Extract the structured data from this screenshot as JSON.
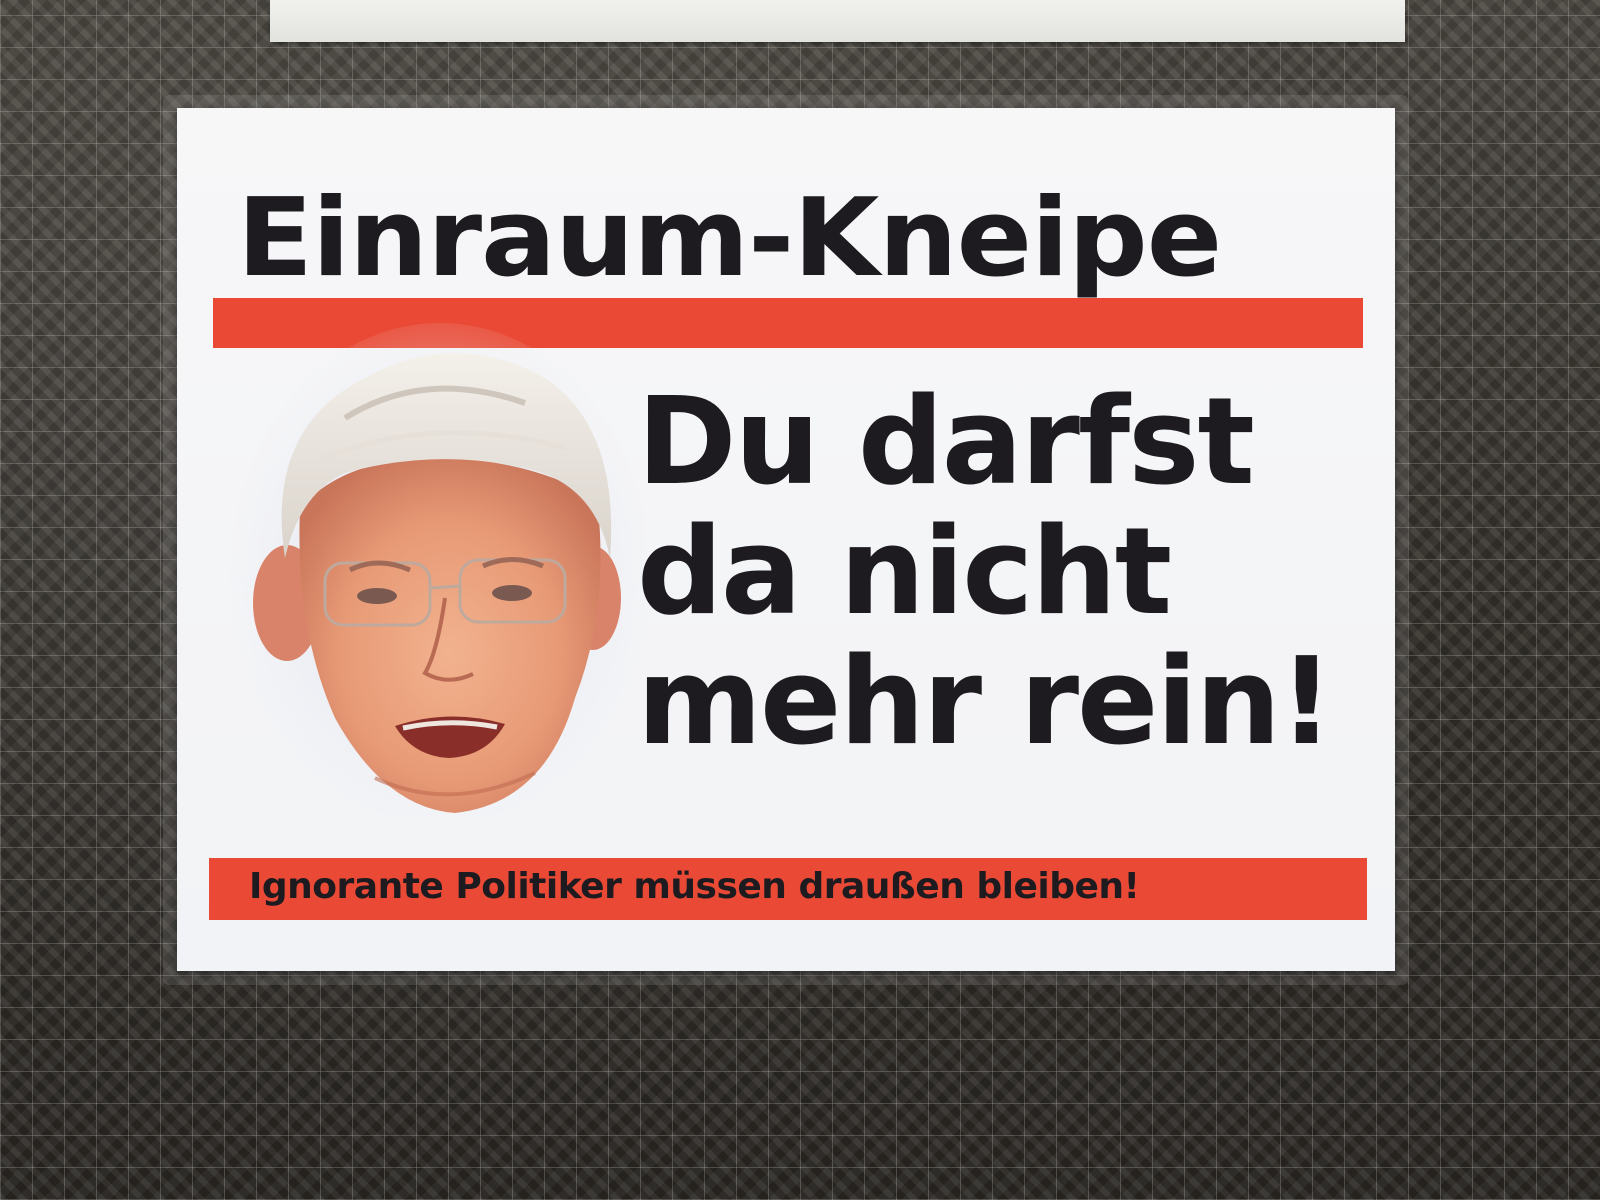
{
  "poster": {
    "headline": "Einraum-Kneipe",
    "slogan_lines": [
      "Du darfst",
      "da nicht",
      "mehr rein!"
    ],
    "tagline": "Ignorante Politiker müssen draußen bleiben!"
  },
  "colors": {
    "accent_red": "#ea4a35",
    "text_dark": "#1d1b1f",
    "paper": "#f4f4f6"
  },
  "portrait": {
    "icon": "man-face-photo"
  }
}
